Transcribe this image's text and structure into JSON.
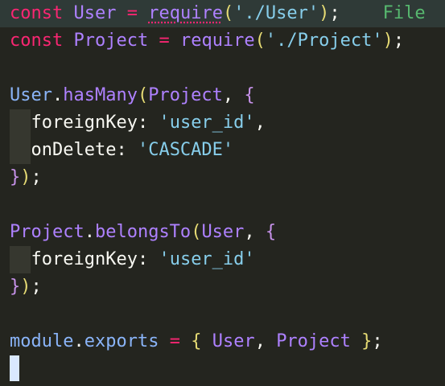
{
  "editor": {
    "lines": [
      {
        "tokens": [
          {
            "text": "const",
            "cls": "kw",
            "name": "keyword-const"
          },
          {
            "text": " ",
            "cls": "prop",
            "name": "space"
          },
          {
            "text": "User",
            "cls": "id",
            "name": "identifier-user"
          },
          {
            "text": " = ",
            "cls": "op",
            "name": "operator-assign"
          },
          {
            "text": "require",
            "cls": "fn squiggle",
            "name": "function-require"
          },
          {
            "text": "(",
            "cls": "brace2",
            "name": "paren-open"
          },
          {
            "text": "'./User'",
            "cls": "str",
            "name": "string-user-path"
          },
          {
            "text": ")",
            "cls": "brace2",
            "name": "paren-close"
          },
          {
            "text": ";",
            "cls": "punc",
            "name": "semicolon"
          },
          {
            "text": "    File",
            "cls": "ghost",
            "name": "ghost-text-file"
          }
        ]
      },
      {
        "tokens": [
          {
            "text": "const",
            "cls": "kw",
            "name": "keyword-const"
          },
          {
            "text": " ",
            "cls": "prop",
            "name": "space"
          },
          {
            "text": "Project",
            "cls": "id",
            "name": "identifier-project"
          },
          {
            "text": " = ",
            "cls": "op",
            "name": "operator-assign"
          },
          {
            "text": "require",
            "cls": "fn",
            "name": "function-require"
          },
          {
            "text": "(",
            "cls": "brace2",
            "name": "paren-open"
          },
          {
            "text": "'./Project'",
            "cls": "str",
            "name": "string-project-path"
          },
          {
            "text": ")",
            "cls": "brace2",
            "name": "paren-close"
          },
          {
            "text": ";",
            "cls": "punc",
            "name": "semicolon"
          }
        ]
      },
      {
        "tokens": []
      },
      {
        "tokens": [
          {
            "text": "User",
            "cls": "obj",
            "name": "object-user"
          },
          {
            "text": ".",
            "cls": "punc",
            "name": "dot"
          },
          {
            "text": "hasMany",
            "cls": "method",
            "name": "method-hasmany"
          },
          {
            "text": "(",
            "cls": "brace2",
            "name": "paren-open"
          },
          {
            "text": "Project",
            "cls": "id",
            "name": "arg-project"
          },
          {
            "text": ", ",
            "cls": "punc",
            "name": "comma"
          },
          {
            "text": "{",
            "cls": "brace1",
            "name": "brace-open"
          }
        ]
      },
      {
        "indent": true,
        "tokens": [
          {
            "text": "  foreignKey",
            "cls": "key",
            "name": "key-foreignkey"
          },
          {
            "text": ": ",
            "cls": "punc",
            "name": "colon"
          },
          {
            "text": "'user_id'",
            "cls": "str",
            "name": "string-user-id"
          },
          {
            "text": ",",
            "cls": "punc",
            "name": "comma"
          }
        ]
      },
      {
        "indent": true,
        "tokens": [
          {
            "text": "  onDelete",
            "cls": "key",
            "name": "key-ondelete"
          },
          {
            "text": ": ",
            "cls": "punc",
            "name": "colon"
          },
          {
            "text": "'CASCADE'",
            "cls": "str",
            "name": "string-cascade"
          }
        ]
      },
      {
        "tokens": [
          {
            "text": "}",
            "cls": "brace1",
            "name": "brace-close"
          },
          {
            "text": ")",
            "cls": "brace2",
            "name": "paren-close"
          },
          {
            "text": ";",
            "cls": "punc",
            "name": "semicolon"
          }
        ]
      },
      {
        "tokens": []
      },
      {
        "tokens": [
          {
            "text": "Project",
            "cls": "id",
            "name": "object-project"
          },
          {
            "text": ".",
            "cls": "punc",
            "name": "dot"
          },
          {
            "text": "belongsTo",
            "cls": "method",
            "name": "method-belongsto"
          },
          {
            "text": "(",
            "cls": "brace2",
            "name": "paren-open"
          },
          {
            "text": "User",
            "cls": "id",
            "name": "arg-user"
          },
          {
            "text": ", ",
            "cls": "punc",
            "name": "comma"
          },
          {
            "text": "{",
            "cls": "brace1",
            "name": "brace-open"
          }
        ]
      },
      {
        "indent": true,
        "tokens": [
          {
            "text": "  foreignKey",
            "cls": "key",
            "name": "key-foreignkey"
          },
          {
            "text": ": ",
            "cls": "punc",
            "name": "colon"
          },
          {
            "text": "'user_id'",
            "cls": "str",
            "name": "string-user-id"
          }
        ]
      },
      {
        "tokens": [
          {
            "text": "}",
            "cls": "brace1",
            "name": "brace-close"
          },
          {
            "text": ")",
            "cls": "brace2",
            "name": "paren-close"
          },
          {
            "text": ";",
            "cls": "punc",
            "name": "semicolon"
          }
        ]
      },
      {
        "tokens": []
      },
      {
        "tokens": [
          {
            "text": "module",
            "cls": "obj",
            "name": "object-module"
          },
          {
            "text": ".",
            "cls": "punc",
            "name": "dot"
          },
          {
            "text": "exports",
            "cls": "obj",
            "name": "property-exports"
          },
          {
            "text": " = ",
            "cls": "op",
            "name": "operator-assign"
          },
          {
            "text": "{",
            "cls": "brace2",
            "name": "brace-open"
          },
          {
            "text": " User",
            "cls": "id",
            "name": "export-user"
          },
          {
            "text": ", ",
            "cls": "punc",
            "name": "comma"
          },
          {
            "text": "Project",
            "cls": "id",
            "name": "export-project"
          },
          {
            "text": " ",
            "cls": "punc",
            "name": "space"
          },
          {
            "text": "}",
            "cls": "brace2",
            "name": "brace-close"
          },
          {
            "text": ";",
            "cls": "punc",
            "name": "semicolon"
          }
        ]
      }
    ]
  }
}
